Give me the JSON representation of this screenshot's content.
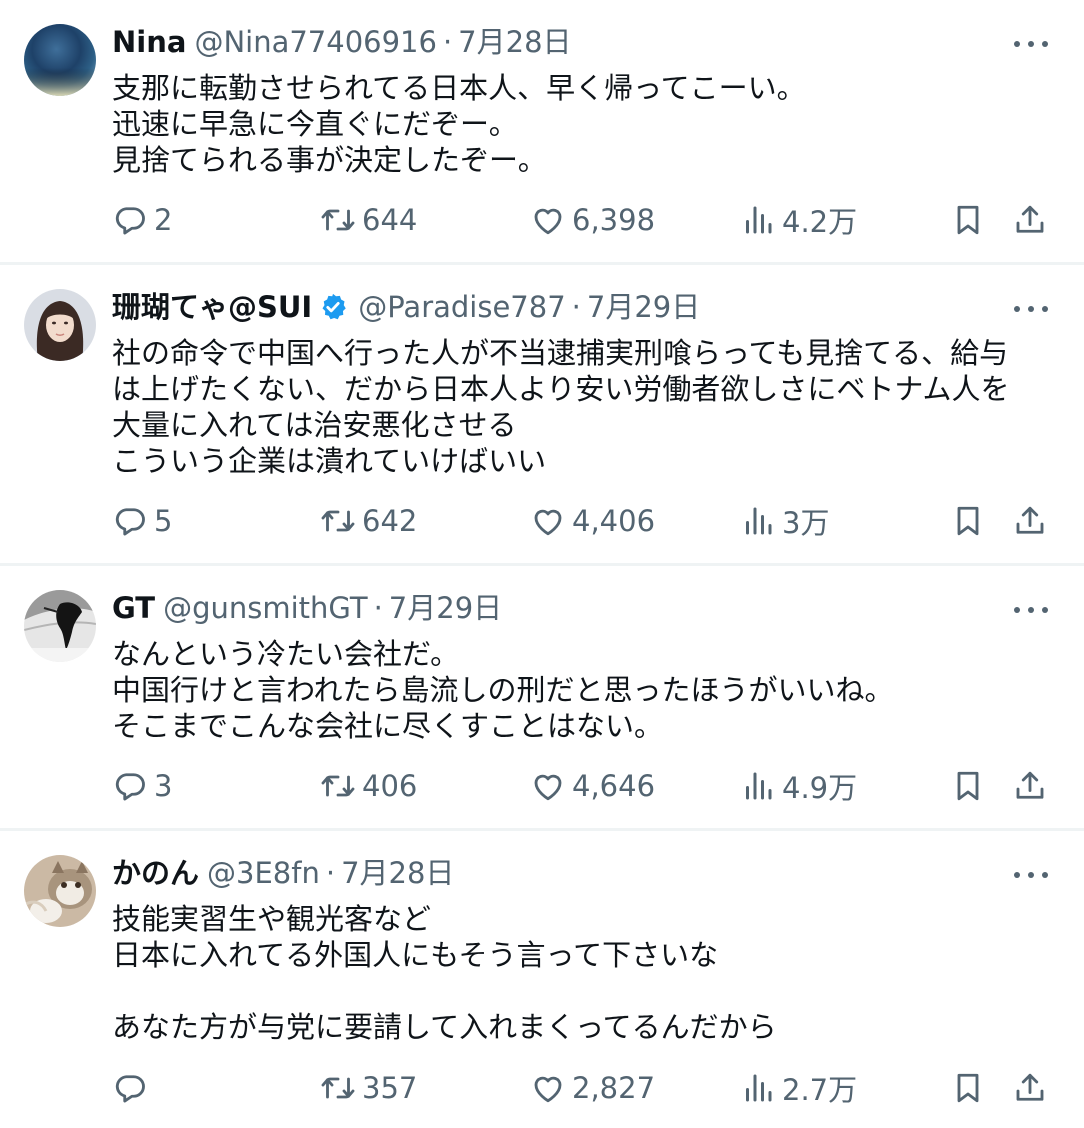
{
  "tweets": [
    {
      "name": "Nina",
      "handle": "@Nina77406916",
      "sep": "·",
      "date": "7月28日",
      "verified": false,
      "lines": [
        "支那に転勤させられてる日本人、早く帰ってこーい。",
        "迅速に早急に今直ぐにだぞー。",
        "見捨てられる事が決定したぞー。"
      ],
      "replies": "2",
      "reposts": "644",
      "likes": "6,398",
      "views": "4.2万"
    },
    {
      "name": "珊瑚てゃ@SUI",
      "handle": "@Paradise787",
      "sep": "·",
      "date": "7月29日",
      "verified": true,
      "lines": [
        "社の命令で中国へ行った人が不当逮捕実刑喰らっても見捨てる、給与",
        "は上げたくない、だから日本人より安い労働者欲しさにベトナム人を",
        "大量に入れては治安悪化させる",
        "こういう企業は潰れていけばいい"
      ],
      "replies": "5",
      "reposts": "642",
      "likes": "4,406",
      "views": "3万"
    },
    {
      "name": "GT",
      "handle": "@gunsmithGT",
      "sep": "·",
      "date": "7月29日",
      "verified": false,
      "lines": [
        "なんという冷たい会社だ。",
        "中国行けと言われたら島流しの刑だと思ったほうがいいね。",
        "そこまでこんな会社に尽くすことはない。"
      ],
      "replies": "3",
      "reposts": "406",
      "likes": "4,646",
      "views": "4.9万"
    },
    {
      "name": "かのん",
      "handle": "@3E8fn",
      "sep": "·",
      "date": "7月28日",
      "verified": false,
      "lines": [
        "技能実習生や観光客など",
        "日本に入れてる外国人にもそう言って下さいな",
        "",
        "あなた方が与党に要請して入れまくってるんだから"
      ],
      "replies": "",
      "reposts": "357",
      "likes": "2,827",
      "views": "2.7万"
    }
  ],
  "icons": {
    "reply": "reply-icon",
    "repost": "repost-icon",
    "like": "like-icon",
    "views": "views-icon",
    "bookmark": "bookmark-icon",
    "share": "share-icon",
    "more": "more-icon",
    "verified": "verified-badge-icon"
  },
  "colors": {
    "text": "#0f1419",
    "secondary": "#536471",
    "verified": "#1d9bf0",
    "divider": "#eff3f4"
  }
}
